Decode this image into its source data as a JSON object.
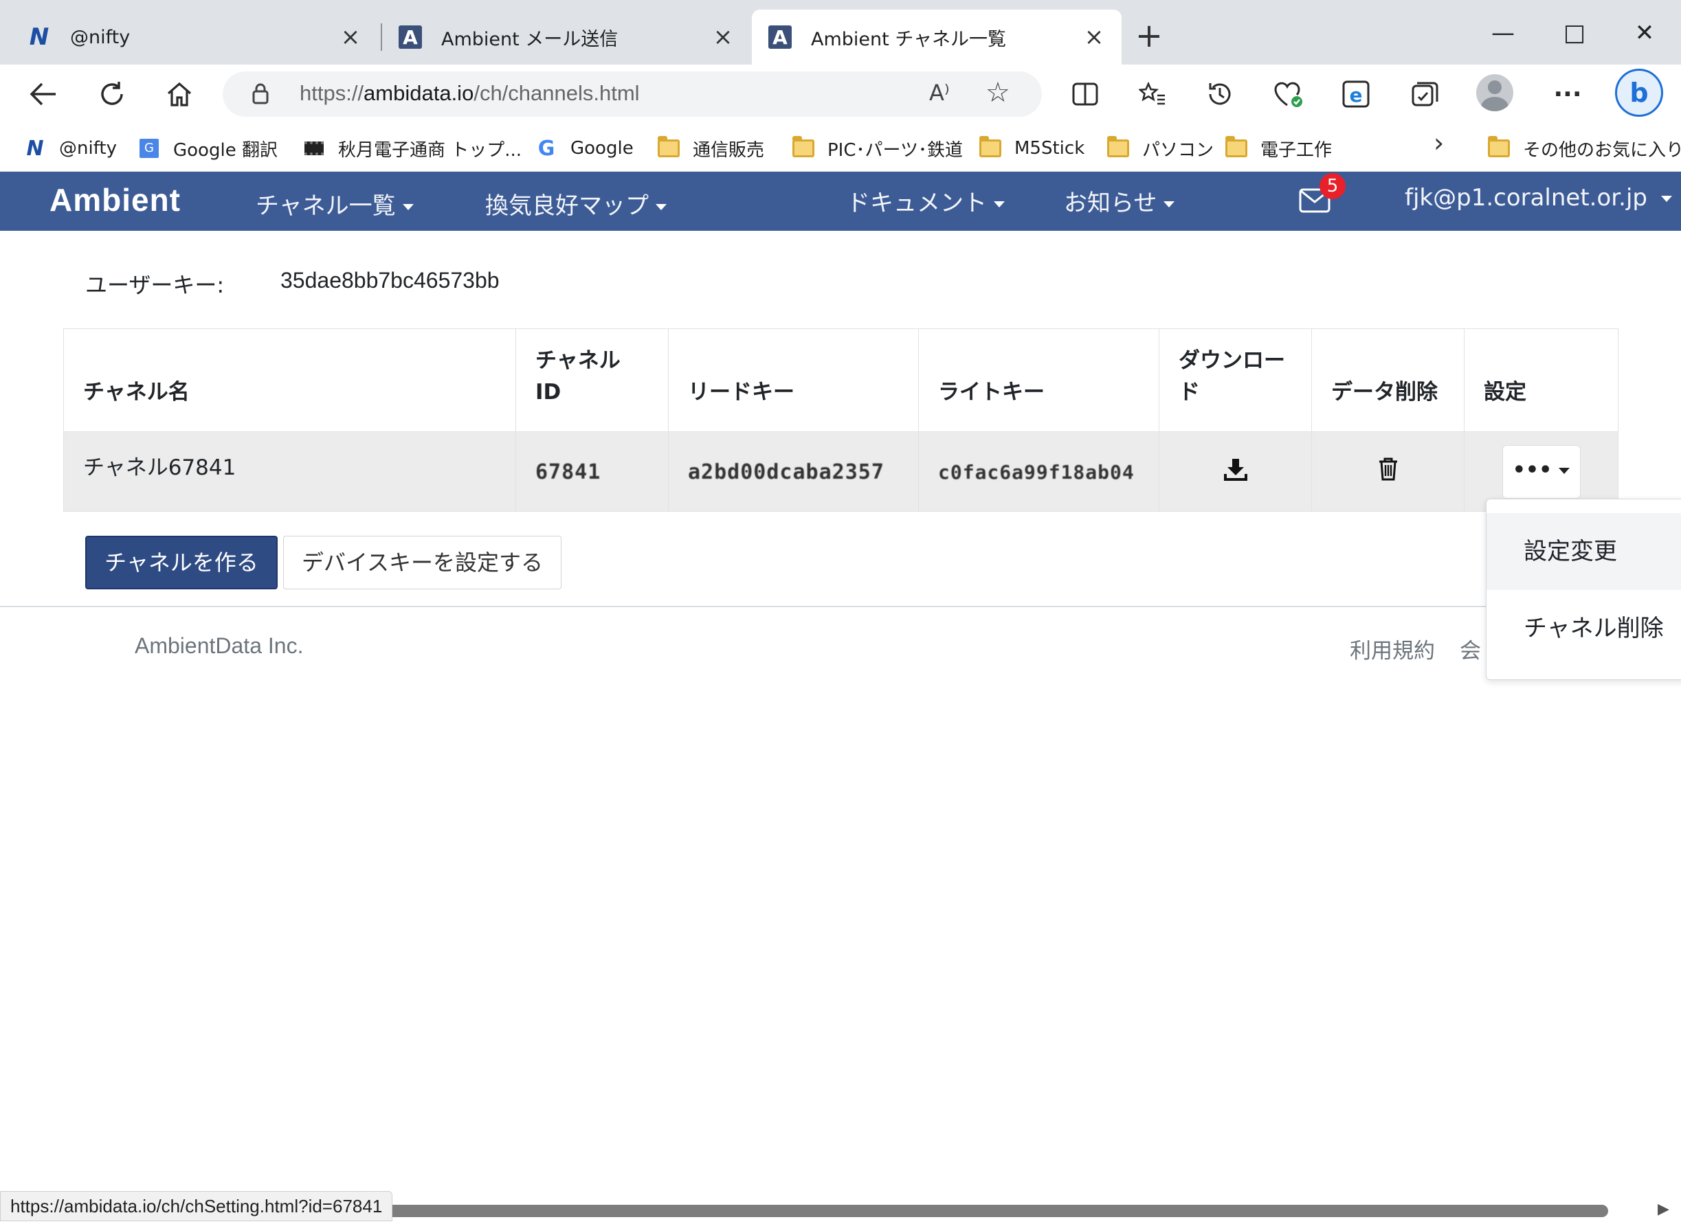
{
  "browser": {
    "tabs": [
      {
        "title": "@nifty",
        "icon": "nifty-icon"
      },
      {
        "title": "Ambient メール送信",
        "icon": "ambient-icon"
      },
      {
        "title": "Ambient チャネル一覧",
        "icon": "ambient-icon",
        "active": true
      }
    ],
    "address": {
      "scheme": "https://",
      "host": "ambidata.io",
      "path": "/ch/channels.html"
    },
    "bookmarks": [
      {
        "label": "@nifty",
        "icon": "nifty-icon"
      },
      {
        "label": "Google 翻訳",
        "icon": "google-translate-icon"
      },
      {
        "label": "秋月電子通商 トップ...",
        "icon": "chip-icon"
      },
      {
        "label": "Google",
        "icon": "google-icon"
      },
      {
        "label": "通信販売",
        "icon": "folder-icon"
      },
      {
        "label": "PIC･パーツ･鉄道",
        "icon": "folder-icon"
      },
      {
        "label": "M5Stick",
        "icon": "folder-icon"
      },
      {
        "label": "パソコン",
        "icon": "folder-icon"
      },
      {
        "label": "電子工作",
        "icon": "folder-icon"
      },
      {
        "label": "その他のお気に入り",
        "icon": "folder-icon"
      }
    ],
    "status_url": "https://ambidata.io/ch/chSetting.html?id=67841"
  },
  "navbar": {
    "brand": "Ambient",
    "items": [
      "チャネル一覧",
      "換気良好マップ",
      "ドキュメント",
      "お知らせ"
    ],
    "mail_badge": "5",
    "user": "fjk@p1.coralnet.or.jp",
    "accent": "#3d5c96"
  },
  "user_key": {
    "label": "ユーザーキー:",
    "value": "35dae8bb7bc46573bb"
  },
  "table": {
    "headers": {
      "name": "チャネル名",
      "id_line1": "チャネル",
      "id_line2": "ID",
      "read_key": "リードキー",
      "write_key": "ライトキー",
      "download_line1": "ダウンロー",
      "download_line2": "ド",
      "delete_data": "データ削除",
      "settings": "設定"
    },
    "rows": [
      {
        "name": "チャネル67841",
        "id": "67841",
        "read_key": "a2bd00dcaba2357",
        "write_key": "c0fac6a99f18ab04"
      }
    ]
  },
  "buttons": {
    "create_channel": "チャネルを作る",
    "set_device_key": "デバイスキーを設定する"
  },
  "footer": {
    "copyright": "AmbientData Inc.",
    "links": [
      "利用規約",
      "会"
    ]
  },
  "dropdown": {
    "items": [
      "設定変更",
      "チャネル削除"
    ]
  }
}
